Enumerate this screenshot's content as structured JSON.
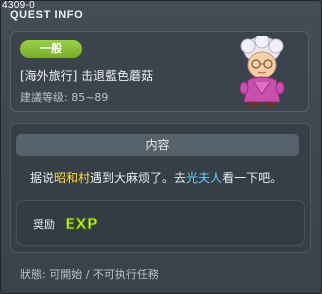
{
  "window": {
    "quest_id": "4309-0",
    "title": "QUEST INFO"
  },
  "quest": {
    "category": "一般",
    "name": "[海外旅行] 击退藍色蘑菇",
    "level_label": "建議等级: 85~89"
  },
  "content": {
    "header": "内容",
    "desc_prefix": "据说",
    "desc_place": "昭和村",
    "desc_middle": "遇到大麻烦了。去",
    "desc_npc": "光夫人",
    "desc_suffix": "看一下吧。"
  },
  "reward": {
    "label": "奨励",
    "exp_icon": "EXP"
  },
  "status": "狀態: 可開始 / 不可执行任務",
  "colors": {
    "badge": "#8cc43a",
    "highlight_place": "#ffd93a",
    "highlight_npc": "#5fd5ff",
    "exp_icon": "#c4f02a"
  },
  "icons": {
    "npc_portrait": "old-lady-npc-portrait",
    "reward": "exp-icon"
  }
}
